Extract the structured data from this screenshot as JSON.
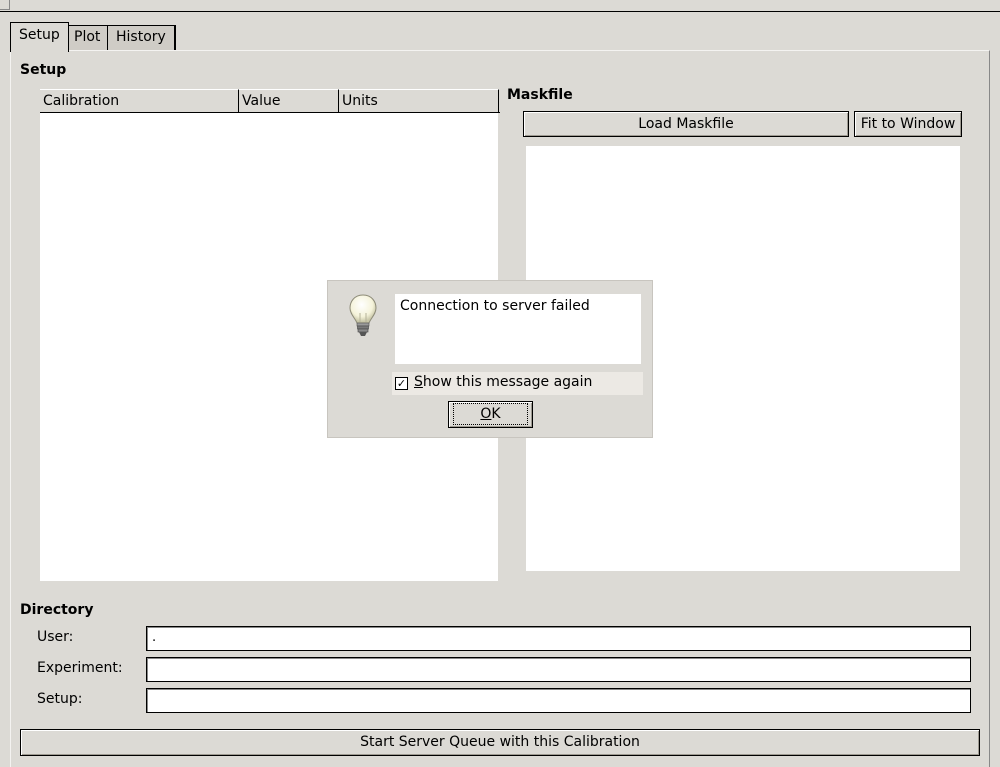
{
  "tabs": [
    "Setup",
    "Plot",
    "History"
  ],
  "setup": {
    "title": "Setup",
    "tree_columns": [
      "Calibration",
      "Value",
      "Units"
    ],
    "maskfile_title": "Maskfile",
    "load_maskfile": "Load Maskfile",
    "fit_to_window": "Fit to Window"
  },
  "directory": {
    "title": "Directory",
    "user_label": "User:",
    "user_value": ".",
    "experiment_label": "Experiment:",
    "experiment_value": "",
    "setup_label": "Setup:",
    "setup_value": ""
  },
  "start_button": "Start Server Queue with this Calibration",
  "dialog": {
    "icon": "lightbulb-icon",
    "message": "Connection to server failed",
    "checkbox_mnemonic": "S",
    "checkbox_rest": "how this message again",
    "checkbox_checked": true,
    "ok_mnemonic": "O",
    "ok_rest": "K"
  }
}
